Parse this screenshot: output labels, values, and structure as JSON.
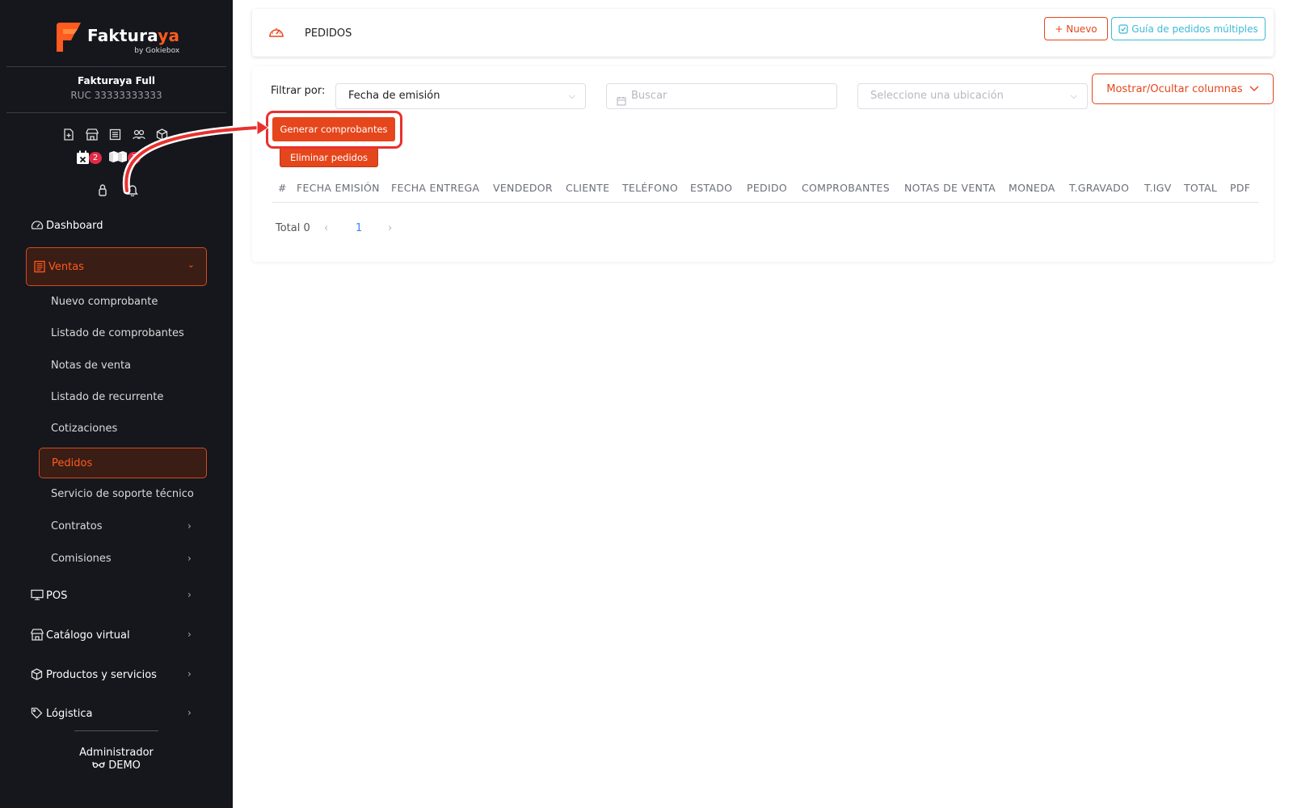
{
  "brand": {
    "name_main": "Faktura",
    "name_accent": "ya",
    "sub": "by Gokiebox"
  },
  "company": {
    "name": "Fakturaya Full",
    "ruc": "RUC 33333333333"
  },
  "quick_badges": {
    "calendar": "2",
    "boxes": "3"
  },
  "nav": {
    "dashboard": "Dashboard",
    "ventas": "Ventas",
    "ventas_items": [
      "Nuevo comprobante",
      "Listado de comprobantes",
      "Notas de venta",
      "Listado de recurrente",
      "Cotizaciones",
      "Pedidos",
      "Servicio de soporte técnico",
      "Contratos",
      "Comisiones"
    ],
    "pos": "POS",
    "catalogo": "Catálogo virtual",
    "productos": "Productos y servicios",
    "logistica": "Lógistica"
  },
  "user": {
    "role": "Administrador",
    "mode": "DEMO"
  },
  "header": {
    "title": "PEDIDOS",
    "btn_nuevo": "+ Nuevo",
    "btn_guia": "Guía de pedidos múltiples"
  },
  "filters": {
    "label": "Filtrar por:",
    "field_value": "Fecha de emisión",
    "search_placeholder": "Buscar",
    "location_placeholder": "Seleccione una ubicación",
    "btn_columns": "Mostrar/Ocultar columnas"
  },
  "actions": {
    "generar": "Generar comprobantes",
    "eliminar": "Eliminar pedidos"
  },
  "table": {
    "columns": [
      "#",
      "FECHA EMISIÓN",
      "FECHA ENTREGA",
      "VENDEDOR",
      "CLIENTE",
      "TELÉFONO",
      "ESTADO",
      "PEDIDO",
      "COMPROBANTES",
      "NOTAS DE VENTA",
      "MONEDA",
      "T.GRAVADO",
      "T.IGV",
      "TOTAL",
      "PDF"
    ]
  },
  "pagination": {
    "total": "Total 0",
    "page": "1",
    "prev": "‹",
    "next": "›"
  },
  "colors": {
    "accent": "#e6461b",
    "info": "#3dbad8",
    "sidebar": "#15171d",
    "highlight": "#e8312e"
  }
}
